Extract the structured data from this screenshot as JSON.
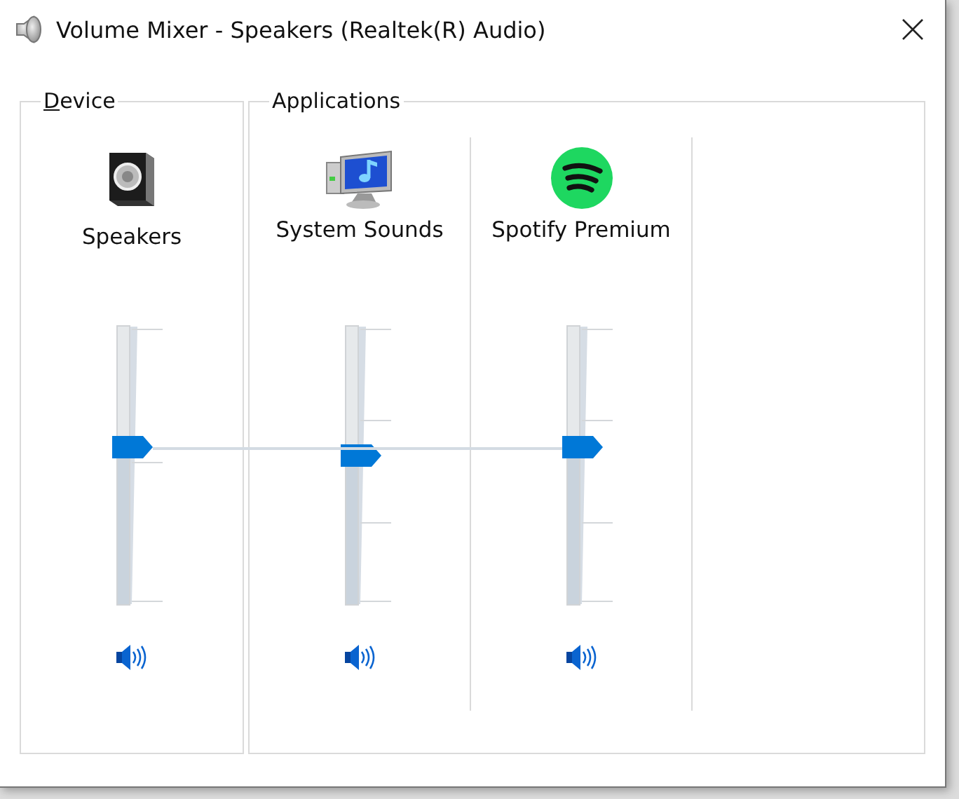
{
  "window": {
    "title": "Volume Mixer - Speakers (Realtek(R) Audio)"
  },
  "device": {
    "label": "Device",
    "channels": [
      {
        "name": "Speakers",
        "kind": "speaker-box",
        "level": 0.57,
        "muted": false
      }
    ]
  },
  "applications": {
    "label": "Applications",
    "channels": [
      {
        "name": "System Sounds",
        "kind": "monitor",
        "level": 0.54,
        "muted": false
      },
      {
        "name": "Spotify Premium",
        "kind": "spotify",
        "level": 0.57,
        "muted": false
      }
    ]
  }
}
